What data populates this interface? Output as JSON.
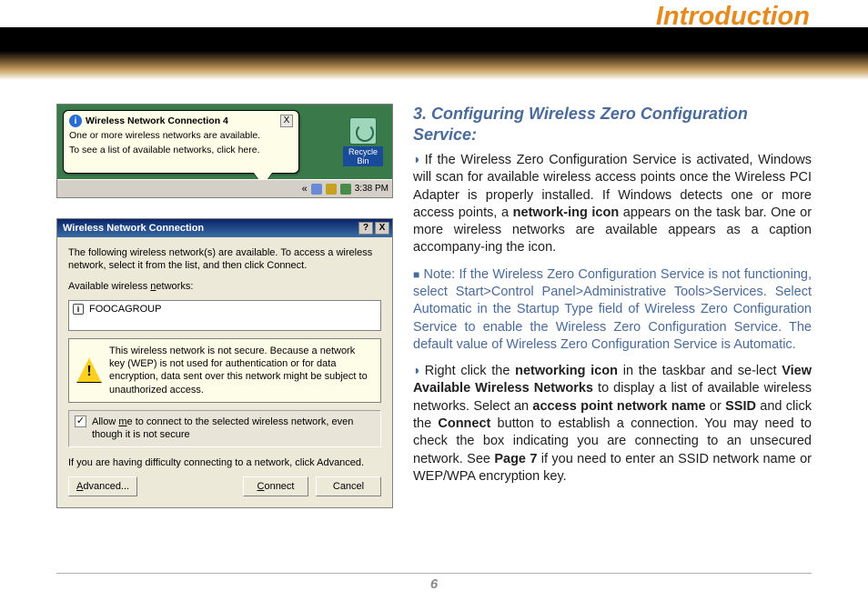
{
  "page": {
    "title": "Introduction",
    "number": "6"
  },
  "balloon": {
    "title": "Wireless Network Connection 4",
    "line1": "One or more wireless networks are available.",
    "line2": "To see a list of available networks, click here.",
    "close": "X"
  },
  "recycle": {
    "label": "Recycle Bin"
  },
  "taskbar": {
    "chevron": "«",
    "time": "3:38 PM"
  },
  "dialog": {
    "title": "Wireless Network Connection",
    "help": "?",
    "close": "X",
    "intro": "The following wireless network(s) are available. To access a wireless network, select it from the list, and then click Connect.",
    "list_label_pre": "Available wireless ",
    "list_label_u": "n",
    "list_label_post": "etworks:",
    "ap_icon": "i",
    "ap_name": "FOOCAGROUP",
    "warning": "This wireless network is not secure. Because a network key (WEP) is not used for authentication or for data encryption, data sent over this network might be subject to unauthorized access.",
    "checkbox_mark": "✓",
    "checkbox_pre": "Allow ",
    "checkbox_u": "m",
    "checkbox_post": "e to connect to the selected wireless network, even though it is not secure",
    "advice": "If you are having difficulty connecting to a network, click Advanced.",
    "btn_advanced_u": "A",
    "btn_advanced_post": "dvanced...",
    "btn_connect_u": "C",
    "btn_connect_post": "onnect",
    "btn_cancel": "Cancel"
  },
  "doc": {
    "heading": "3. Configuring Wireless Zero Configuration Service:",
    "p1a": "If the Wireless Zero Configuration Service is activated, Windows will scan for available wireless access points once the Wireless PCI Adapter is properly installed. If Windows detects one or more access points, a ",
    "p1b": "network-ing icon",
    "p1c": " appears on the task bar.  One or more wireless networks are available appears as a caption accompany-ing the icon.",
    "note": "Note: If the Wireless Zero Configuration Service is not functioning, select Start>Control Panel>Administrative Tools>Services. Select Automatic in the Startup Type field of Wireless Zero Configuration Service to enable the Wireless Zero Configuration Service. The default value of Wireless Zero Configuration Service is Automatic.",
    "p2a": "Right click the ",
    "p2b": "networking icon",
    "p2c": " in the taskbar and se-lect ",
    "p2d": "View Available Wireless Networks",
    "p2e": " to display a list of available wireless networks.  Select an ",
    "p2f": "access point network name",
    "p2g": " or ",
    "p2h": "SSID",
    "p2i": " and click the ",
    "p2j": "Connect",
    "p2k": " button to establish a connection.  You may need to check the box indicating you are connecting to an unsecured network.  See ",
    "p2l": "Page 7",
    "p2m": " if you need to enter an SSID network name or WEP/WPA encryption key."
  }
}
